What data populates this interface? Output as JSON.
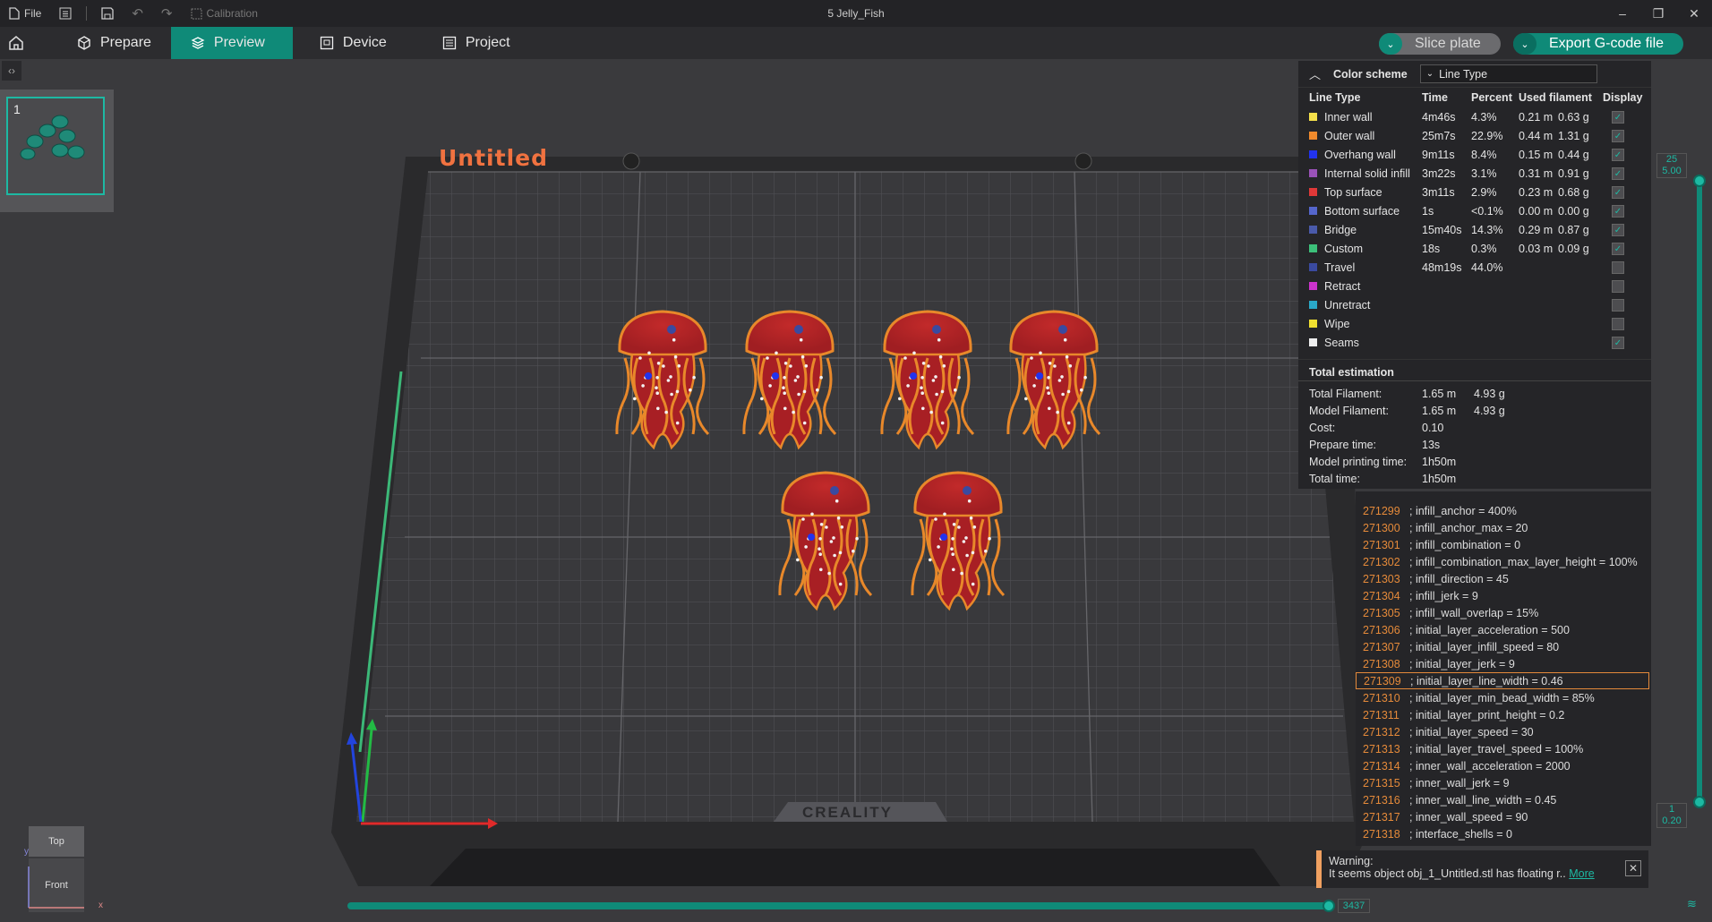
{
  "titlebar": {
    "file_label": "File",
    "calibration_label": "Calibration",
    "window_title": "5 Jelly_Fish",
    "minimize": "–",
    "restore": "❐",
    "close": "✕"
  },
  "tabs": [
    {
      "label": "Prepare",
      "icon": "cube-icon"
    },
    {
      "label": "Preview",
      "icon": "layers-icon"
    },
    {
      "label": "Device",
      "icon": "device-icon"
    },
    {
      "label": "Project",
      "icon": "project-icon"
    }
  ],
  "actions": {
    "slice_label": "Slice plate",
    "export_label": "Export G-code file"
  },
  "plate": {
    "name": "Untitled",
    "brand": "CREALITY",
    "thumb_number": "1"
  },
  "legend": {
    "title": "Color scheme",
    "scheme": "Line Type",
    "columns": [
      "Line Type",
      "Time",
      "Percent",
      "Used filament",
      "Display"
    ],
    "rows": [
      {
        "name": "Inner wall",
        "color": "#f5e04a",
        "time": "4m46s",
        "percent": "4.3%",
        "len": "0.21 m",
        "weight": "0.63 g",
        "checked": true
      },
      {
        "name": "Outer wall",
        "color": "#f08a2c",
        "time": "25m7s",
        "percent": "22.9%",
        "len": "0.44 m",
        "weight": "1.31 g",
        "checked": true
      },
      {
        "name": "Overhang wall",
        "color": "#2233ee",
        "time": "9m11s",
        "percent": "8.4%",
        "len": "0.15 m",
        "weight": "0.44 g",
        "checked": true
      },
      {
        "name": "Internal solid infill",
        "color": "#9a52b8",
        "time": "3m22s",
        "percent": "3.1%",
        "len": "0.31 m",
        "weight": "0.91 g",
        "checked": true
      },
      {
        "name": "Top surface",
        "color": "#e03838",
        "time": "3m11s",
        "percent": "2.9%",
        "len": "0.23 m",
        "weight": "0.68 g",
        "checked": true
      },
      {
        "name": "Bottom surface",
        "color": "#5566cc",
        "time": "1s",
        "percent": "<0.1%",
        "len": "0.00 m",
        "weight": "0.00 g",
        "checked": true
      },
      {
        "name": "Bridge",
        "color": "#4a5aaa",
        "time": "15m40s",
        "percent": "14.3%",
        "len": "0.29 m",
        "weight": "0.87 g",
        "checked": true
      },
      {
        "name": "Custom",
        "color": "#3cc07a",
        "time": "18s",
        "percent": "0.3%",
        "len": "0.03 m",
        "weight": "0.09 g",
        "checked": true
      },
      {
        "name": "Travel",
        "color": "#3a4aa0",
        "time": "48m19s",
        "percent": "44.0%",
        "len": "",
        "weight": "",
        "checked": false
      },
      {
        "name": "Retract",
        "color": "#cc33cc",
        "time": "",
        "percent": "",
        "len": "",
        "weight": "",
        "checked": false
      },
      {
        "name": "Unretract",
        "color": "#2aa8c8",
        "time": "",
        "percent": "",
        "len": "",
        "weight": "",
        "checked": false
      },
      {
        "name": "Wipe",
        "color": "#f0e030",
        "time": "",
        "percent": "",
        "len": "",
        "weight": "",
        "checked": false
      },
      {
        "name": "Seams",
        "color": "#eeeeee",
        "time": "",
        "percent": "",
        "len": "",
        "weight": "",
        "checked": true
      }
    ],
    "total_title": "Total estimation",
    "totals": [
      {
        "label": "Total Filament:",
        "v1": "1.65 m",
        "v2": "4.93 g"
      },
      {
        "label": "Model Filament:",
        "v1": "1.65 m",
        "v2": "4.93 g"
      },
      {
        "label": "Cost:",
        "v1": "0.10",
        "v2": ""
      },
      {
        "label": "Prepare time:",
        "v1": "13s",
        "v2": ""
      },
      {
        "label": "Model printing time:",
        "v1": "1h50m",
        "v2": ""
      },
      {
        "label": "Total time:",
        "v1": "1h50m",
        "v2": ""
      }
    ]
  },
  "gcode": [
    {
      "n": "271299",
      "t": "; infill_anchor = 400%"
    },
    {
      "n": "271300",
      "t": "; infill_anchor_max = 20"
    },
    {
      "n": "271301",
      "t": "; infill_combination = 0"
    },
    {
      "n": "271302",
      "t": "; infill_combination_max_layer_height = 100%"
    },
    {
      "n": "271303",
      "t": "; infill_direction = 45"
    },
    {
      "n": "271304",
      "t": "; infill_jerk = 9"
    },
    {
      "n": "271305",
      "t": "; infill_wall_overlap = 15%"
    },
    {
      "n": "271306",
      "t": "; initial_layer_acceleration = 500"
    },
    {
      "n": "271307",
      "t": "; initial_layer_infill_speed = 80"
    },
    {
      "n": "271308",
      "t": "; initial_layer_jerk = 9"
    },
    {
      "n": "271309",
      "t": "; initial_layer_line_width = 0.46"
    },
    {
      "n": "271310",
      "t": "; initial_layer_min_bead_width = 85%"
    },
    {
      "n": "271311",
      "t": "; initial_layer_print_height = 0.2"
    },
    {
      "n": "271312",
      "t": "; initial_layer_speed = 30"
    },
    {
      "n": "271313",
      "t": "; initial_layer_travel_speed = 100%"
    },
    {
      "n": "271314",
      "t": "; inner_wall_acceleration = 2000"
    },
    {
      "n": "271315",
      "t": "; inner_wall_jerk = 9"
    },
    {
      "n": "271316",
      "t": "; inner_wall_line_width = 0.45"
    },
    {
      "n": "271317",
      "t": "; inner_wall_speed = 90"
    },
    {
      "n": "271318",
      "t": "; interface_shells = 0"
    }
  ],
  "gcode_selected": "271309",
  "warning": {
    "title": "Warning:",
    "text": "It seems object obj_1_Untitled.stl has floating r..",
    "link": "More"
  },
  "slider": {
    "top_layer": "25",
    "top_height": "5.00",
    "bottom_layer": "1",
    "bottom_height": "0.20",
    "move_value": "3437"
  },
  "navcube": {
    "top": "Top",
    "front": "Front",
    "axis_x": "x",
    "axis_y": "y"
  }
}
